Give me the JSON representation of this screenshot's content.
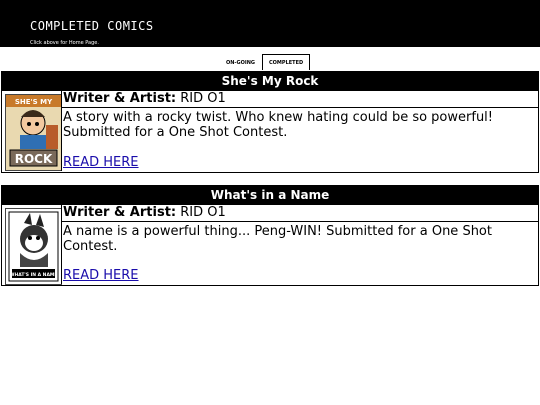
{
  "header": {
    "title": "Completed Comics",
    "subtitle": "Click above for Home Page."
  },
  "tabs": [
    {
      "label": "On-Going",
      "active": false
    },
    {
      "label": "Completed",
      "active": true
    }
  ],
  "comics": [
    {
      "title": "She's My Rock",
      "writer_label": "Writer & Artist:",
      "writer": "RID O1",
      "description": "A story with a rocky twist. Who knew hating could be so powerful! Submitted for a One Shot Contest.",
      "link": "READ HERE",
      "thumb_top": "SHE'S MY",
      "thumb_bottom": "ROCK"
    },
    {
      "title": "What's in a Name",
      "writer_label": "Writer & Artist:",
      "writer": "RID O1",
      "description": "A name is a powerful thing... Peng-WIN! Submitted for a One Shot Contest.",
      "link": "READ HERE",
      "thumb_caption": "WHAT'S IN A NAME"
    }
  ]
}
